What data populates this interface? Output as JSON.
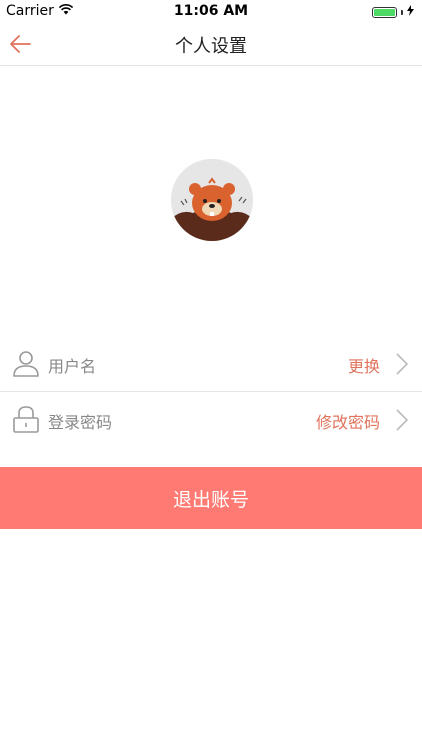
{
  "status_bar": {
    "carrier": "Carrier",
    "time": "11:06 AM",
    "battery_level": 1.0
  },
  "nav": {
    "title": "个人设置",
    "back_icon": "arrow-left-icon"
  },
  "profile": {
    "avatar_icon": "bear-avatar"
  },
  "rows": {
    "username": {
      "icon": "user-icon",
      "label": "用户名",
      "action": "更换"
    },
    "password": {
      "icon": "lock-icon",
      "label": "登录密码",
      "action": "修改密码"
    }
  },
  "logout": {
    "label": "退出账号"
  },
  "colors": {
    "accent": "#e0735c",
    "logout_bg": "#ff7a72",
    "back_arrow": "#e0735c",
    "battery": "#4cd964"
  }
}
